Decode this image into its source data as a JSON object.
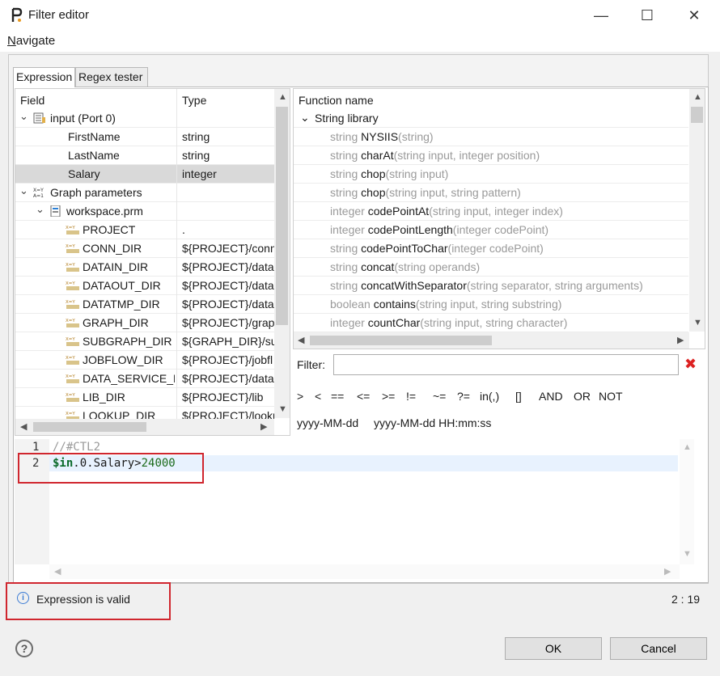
{
  "window": {
    "title": "Filter editor",
    "min_glyph": "—",
    "max_glyph": "☐",
    "close_glyph": "✕"
  },
  "menu": {
    "navigate_prefix": "N",
    "navigate_rest": "avigate"
  },
  "tabs": [
    {
      "label": "Expression",
      "active": true
    },
    {
      "label": "Regex tester",
      "active": false
    }
  ],
  "field_table": {
    "headers": {
      "field": "Field",
      "type": "Type"
    },
    "rows": [
      {
        "level": 0,
        "expander": "⌄",
        "icon": "record-icon",
        "label": "input (Port 0)",
        "type": ""
      },
      {
        "level": 2,
        "expander": "",
        "icon": "",
        "label": "FirstName",
        "type": "string"
      },
      {
        "level": 2,
        "expander": "",
        "icon": "",
        "label": "LastName",
        "type": "string"
      },
      {
        "level": 2,
        "expander": "",
        "icon": "",
        "label": "Salary",
        "type": "integer",
        "selected": true
      },
      {
        "level": 0,
        "expander": "⌄",
        "icon": "graph-params-icon",
        "label": "Graph parameters",
        "type": ""
      },
      {
        "level": 1,
        "expander": "⌄",
        "icon": "params-file-icon",
        "label": "workspace.prm",
        "type": ""
      },
      {
        "level": 2,
        "expander": "",
        "icon": "parameter-icon",
        "label": "PROJECT",
        "type": "."
      },
      {
        "level": 2,
        "expander": "",
        "icon": "parameter-icon",
        "label": "CONN_DIR",
        "type": "${PROJECT}/conn"
      },
      {
        "level": 2,
        "expander": "",
        "icon": "parameter-icon",
        "label": "DATAIN_DIR",
        "type": "${PROJECT}/data"
      },
      {
        "level": 2,
        "expander": "",
        "icon": "parameter-icon",
        "label": "DATAOUT_DIR",
        "type": "${PROJECT}/data"
      },
      {
        "level": 2,
        "expander": "",
        "icon": "parameter-icon",
        "label": "DATATMP_DIR",
        "type": "${PROJECT}/data"
      },
      {
        "level": 2,
        "expander": "",
        "icon": "parameter-icon",
        "label": "GRAPH_DIR",
        "type": "${PROJECT}/grap"
      },
      {
        "level": 2,
        "expander": "",
        "icon": "parameter-icon",
        "label": "SUBGRAPH_DIR",
        "type": "${GRAPH_DIR}/su"
      },
      {
        "level": 2,
        "expander": "",
        "icon": "parameter-icon",
        "label": "JOBFLOW_DIR",
        "type": "${PROJECT}/jobfl"
      },
      {
        "level": 2,
        "expander": "",
        "icon": "parameter-icon",
        "label": "DATA_SERVICE_D",
        "type": "${PROJECT}/data"
      },
      {
        "level": 2,
        "expander": "",
        "icon": "parameter-icon",
        "label": "LIB_DIR",
        "type": "${PROJECT}/lib"
      },
      {
        "level": 2,
        "expander": "",
        "icon": "parameter-icon",
        "label": "LOOKUP_DIR",
        "type": "${PROJECT}/looku"
      }
    ]
  },
  "function_list": {
    "header": "Function name",
    "group": {
      "expander": "⌄",
      "label": "String library"
    },
    "items": [
      {
        "ret": "string",
        "name": "NYSIIS",
        "args": "(string)"
      },
      {
        "ret": "string",
        "name": "charAt",
        "args": "(string input, integer position)"
      },
      {
        "ret": "string",
        "name": "chop",
        "args": "(string input)"
      },
      {
        "ret": "string",
        "name": "chop",
        "args": "(string input, string pattern)"
      },
      {
        "ret": "integer",
        "name": "codePointAt",
        "args": "(string input, integer index)"
      },
      {
        "ret": "integer",
        "name": "codePointLength",
        "args": "(integer codePoint)"
      },
      {
        "ret": "string",
        "name": "codePointToChar",
        "args": "(integer codePoint)"
      },
      {
        "ret": "string",
        "name": "concat",
        "args": "(string operands)"
      },
      {
        "ret": "string",
        "name": "concatWithSeparator",
        "args": "(string separator, string arguments)"
      },
      {
        "ret": "boolean",
        "name": "contains",
        "args": "(string input, string substring)"
      },
      {
        "ret": "integer",
        "name": "countChar",
        "args": "(string input, string character)"
      }
    ]
  },
  "filter": {
    "label": "Filter:",
    "value": "",
    "clear_glyph": "✖"
  },
  "operators": [
    ">",
    "<",
    "==",
    "<=",
    ">=",
    "!=",
    "~=",
    "?=",
    "in(,)",
    "[]",
    "AND",
    "OR",
    "NOT"
  ],
  "date_formats": [
    "yyyy-MM-dd",
    "yyyy-MM-dd HH:mm:ss"
  ],
  "editor": {
    "line_numbers": [
      "1",
      "2"
    ],
    "line1": "//#CTL2",
    "line2_var": "$in",
    "line2_rest": ".0.Salary>",
    "line2_num": "24000"
  },
  "status": {
    "icon_glyph": "i",
    "text": "Expression is valid",
    "cursor": "2 : 19"
  },
  "buttons": {
    "help": "?",
    "ok": "OK",
    "cancel": "Cancel"
  },
  "colors": {
    "highlight_red": "#d0262e",
    "selection": "#d9d9d9",
    "current_line": "#e8f2fe"
  }
}
